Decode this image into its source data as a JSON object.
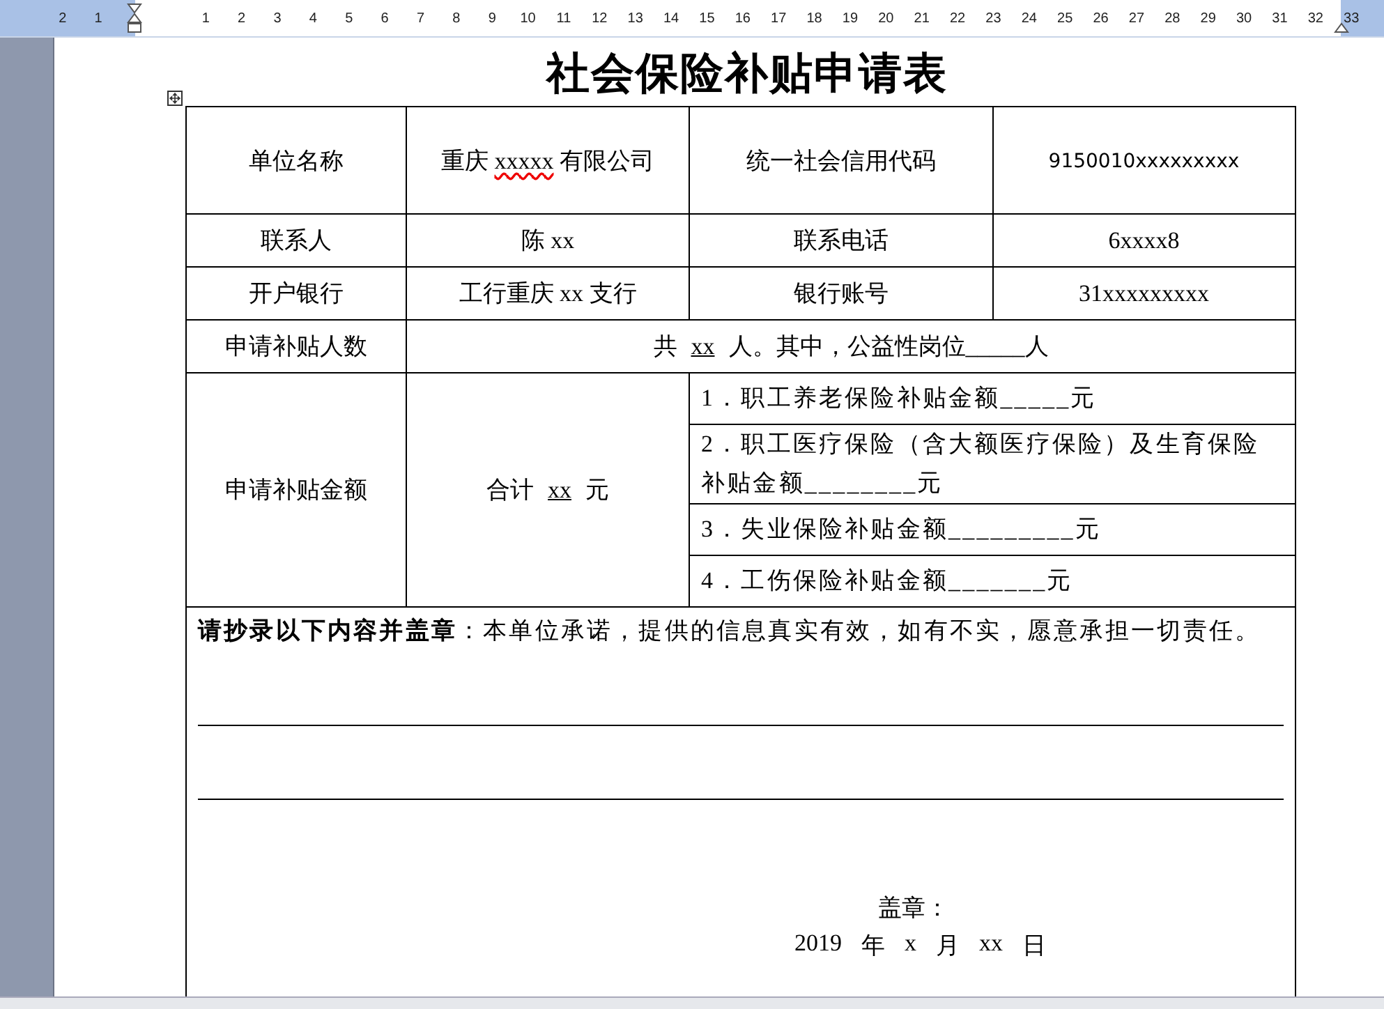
{
  "ruler": {
    "left_labels": [
      "2",
      "1"
    ],
    "labels": [
      "1",
      "2",
      "3",
      "4",
      "5",
      "6",
      "7",
      "8",
      "9",
      "10",
      "11",
      "12",
      "13",
      "14",
      "15",
      "16",
      "17",
      "18",
      "19",
      "20",
      "21",
      "22",
      "23",
      "24",
      "25",
      "26",
      "27",
      "28",
      "29",
      "30",
      "31",
      "32",
      "33"
    ]
  },
  "document": {
    "title": "社会保险补贴申请表",
    "rows": [
      [
        [
          {
            "text": "单位名称"
          }
        ],
        [
          {
            "text": "重庆 "
          },
          {
            "text": "xxxxx",
            "spelling_error": true
          },
          {
            "text": " 有限公司"
          }
        ],
        [
          {
            "text": "统一社会信用代码"
          }
        ],
        [
          {
            "text": "9150010xxxxxxxxx",
            "small": true
          }
        ]
      ],
      [
        [
          {
            "text": "联系人"
          }
        ],
        [
          {
            "text": "陈 xx"
          }
        ],
        [
          {
            "text": "联系电话"
          }
        ],
        [
          {
            "text": "6xxxx8"
          }
        ]
      ],
      [
        [
          {
            "text": "开户银行"
          }
        ],
        [
          {
            "text": "工行重庆 xx 支行"
          }
        ],
        [
          {
            "text": "银行账号"
          }
        ],
        [
          {
            "text": "31xxxxxxxxx"
          }
        ]
      ]
    ],
    "headcount": {
      "label": "申请补贴人数",
      "segments": [
        {
          "text": "共"
        },
        {
          "text": "xx",
          "underlined": true
        },
        {
          "text": "人。其中，公益性岗位_____人"
        }
      ]
    },
    "amount": {
      "label": "申请补贴金额",
      "total": [
        {
          "text": "合计"
        },
        {
          "text": "xx",
          "underlined": true
        },
        {
          "text": "元"
        }
      ],
      "items": [
        "1．职工养老保险补贴金额_____元",
        "2．职工医疗保险（含大额医疗保险）及生育保险补贴金额________元",
        "3．失业保险补贴金额_________元",
        "4．工伤保险补贴金额_______元"
      ]
    },
    "statement": "**请抄录以下内容并盖章**：本单位承诺，提供的信息真实有效，如有不实，愿意承担一切责任。",
    "seal_label": "盖章：",
    "date": [
      "2019",
      "年",
      "x",
      "月",
      "xx",
      "日"
    ]
  }
}
